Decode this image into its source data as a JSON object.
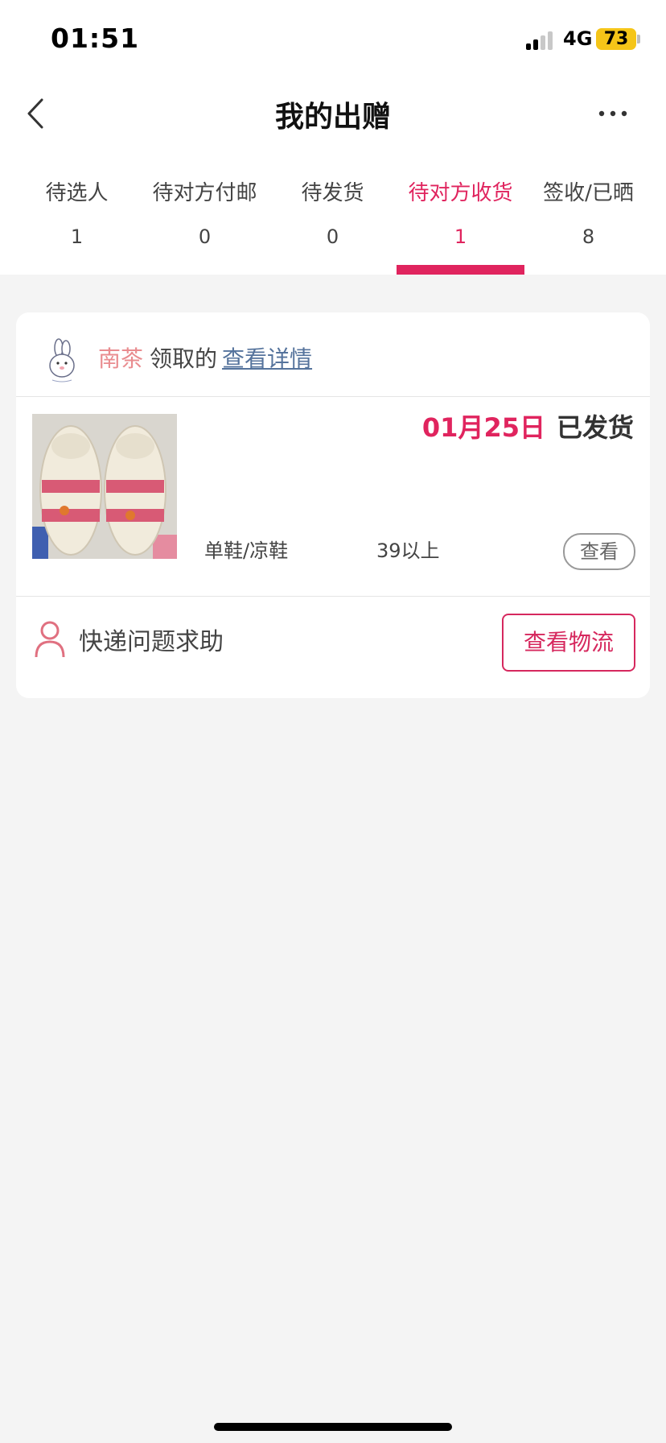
{
  "status_bar": {
    "time": "01:51",
    "network": "4G",
    "battery": "73"
  },
  "header": {
    "title": "我的出赠"
  },
  "tabs": [
    {
      "label": "待选人",
      "count": "1"
    },
    {
      "label": "待对方付邮",
      "count": "0"
    },
    {
      "label": "待发货",
      "count": "0"
    },
    {
      "label": "待对方收货",
      "count": "1"
    },
    {
      "label": "签收/已晒",
      "count": "8"
    }
  ],
  "active_tab": 3,
  "order": {
    "recipient_name": "南茶",
    "claimed_text": "领取的",
    "details_link": "查看详情",
    "ship_date": "01月25日",
    "ship_status": "已发货",
    "category": "单鞋/凉鞋",
    "size": "39以上",
    "view_label": "查看",
    "help_label": "快递问题求助",
    "logistics_label": "查看物流"
  },
  "colors": {
    "accent": "#e0245e",
    "name": "#e98c8f",
    "link": "#55739c",
    "background": "#f4f4f4"
  }
}
